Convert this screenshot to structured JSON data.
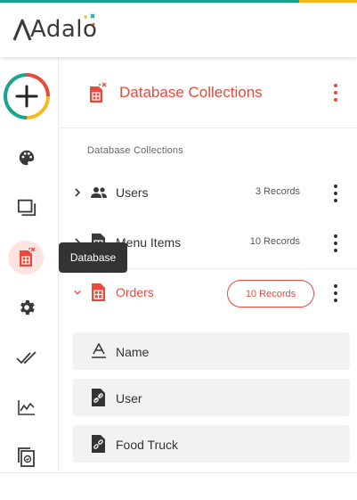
{
  "brand": {
    "logo_text": "Adalo"
  },
  "colors": {
    "accent": "#e84a3c",
    "teal": "#1aa38f",
    "yellow": "#f5b920"
  },
  "sidebar": {
    "items": [
      {
        "name": "add",
        "icon": "plus-icon"
      },
      {
        "name": "branding",
        "icon": "palette-icon"
      },
      {
        "name": "screens",
        "icon": "screens-icon"
      },
      {
        "name": "database",
        "icon": "database-icon",
        "active": true
      },
      {
        "name": "settings",
        "icon": "gear-icon"
      },
      {
        "name": "publish",
        "icon": "double-check-icon"
      },
      {
        "name": "analytics",
        "icon": "analytics-icon"
      },
      {
        "name": "versions",
        "icon": "versions-icon"
      }
    ],
    "tooltip": "Database"
  },
  "main": {
    "title": "Database Collections",
    "section_label": "Database Collections",
    "collections": [
      {
        "name": "Users",
        "count": "3 Records",
        "icon": "users-icon",
        "expanded": false
      },
      {
        "name": "Menu Items",
        "count": "10 Records",
        "icon": "collection-icon",
        "expanded": false
      },
      {
        "name": "Orders",
        "count": "10 Records",
        "icon": "collection-icon",
        "expanded": true
      }
    ],
    "fields": [
      {
        "name": "Name",
        "icon": "text-field-icon"
      },
      {
        "name": "User",
        "icon": "relationship-icon"
      },
      {
        "name": "Food Truck",
        "icon": "relationship-icon"
      }
    ]
  }
}
